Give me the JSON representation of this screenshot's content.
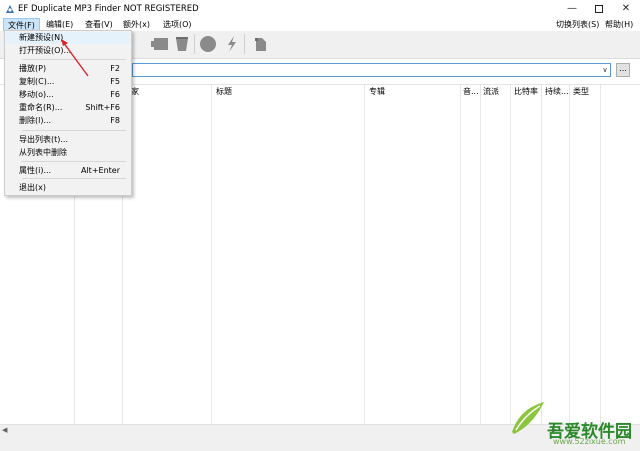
{
  "window": {
    "title": "EF Duplicate MP3 Finder NOT REGISTERED",
    "minimize_icon": "minimize-icon",
    "maximize_icon": "maximize-icon",
    "close_icon": "close-icon"
  },
  "menubar": {
    "items": [
      "文件(F)",
      "编辑(E)",
      "查看(V)",
      "额外(x)",
      "选项(O)"
    ],
    "right_items": [
      "切换列表(S)",
      "帮助(H)"
    ]
  },
  "file_menu": [
    {
      "label": "新建预设(N)",
      "shortcut": ""
    },
    {
      "label": "打开预设(O)...",
      "shortcut": ""
    },
    {
      "label": "播放(P)",
      "shortcut": "F2"
    },
    {
      "label": "复制(C)...",
      "shortcut": "F5"
    },
    {
      "label": "移动(o)...",
      "shortcut": "F6"
    },
    {
      "label": "重命名(R)...",
      "shortcut": "Shift+F6"
    },
    {
      "label": "删除(l)...",
      "shortcut": "F8"
    },
    {
      "label": "导出列表(t)...",
      "shortcut": ""
    },
    {
      "label": "从列表中删除",
      "shortcut": ""
    },
    {
      "label": "属性(i)...",
      "shortcut": "Alt+Enter"
    },
    {
      "label": "退出(x)",
      "shortcut": ""
    }
  ],
  "path_combo": {
    "value": "",
    "browse_label": "..."
  },
  "columns": [
    "术家",
    "标题",
    "专辑",
    "音...",
    "流派",
    "比特率",
    "持续...",
    "类型"
  ],
  "watermark": {
    "text": "吾爱软件园",
    "url": "www.52zixue.com"
  },
  "colors": {
    "accent": "#5a9bd5",
    "menu_highlight": "#cce4f7",
    "arrow": "#d9232a"
  }
}
